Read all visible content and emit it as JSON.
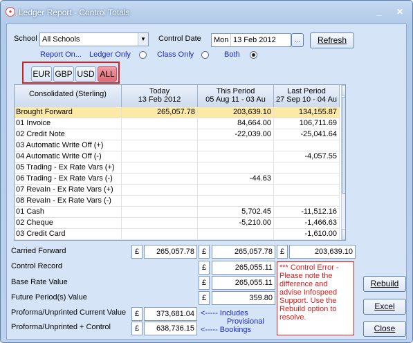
{
  "window": {
    "title": "Ledger Report - Control Totals",
    "icon": "app-icon",
    "minimize": "_",
    "close": "✕"
  },
  "school": {
    "label": "School",
    "value": "All Schools"
  },
  "control_date": {
    "label": "Control Date",
    "day": "Mon",
    "date": "13 Feb 2012",
    "picker": "..."
  },
  "refresh_label": "Refresh",
  "report_on": {
    "label": "Report On...",
    "options": [
      {
        "label": "Ledger Only",
        "selected": false
      },
      {
        "label": "Class Only",
        "selected": false
      },
      {
        "label": "Both",
        "selected": true
      }
    ]
  },
  "currencies": [
    {
      "label": "EUR",
      "active": false
    },
    {
      "label": "GBP",
      "active": false
    },
    {
      "label": "USD",
      "active": false
    },
    {
      "label": "ALL",
      "active": true
    }
  ],
  "grid": {
    "columns": [
      {
        "line1": "Consolidated (Sterling)",
        "line2": ""
      },
      {
        "line1": "Today",
        "line2": "13 Feb 2012"
      },
      {
        "line1": "This Period",
        "line2": "05 Aug 11 - 03 Au"
      },
      {
        "line1": "Last Period",
        "line2": "27 Sep 10 - 04 Au"
      }
    ],
    "rows": [
      {
        "name": "Brought Forward",
        "today": "265,057.78",
        "this": "203,639.10",
        "last": "134,155.87"
      },
      {
        "name": "01 Invoice",
        "today": "",
        "this": "84,664.00",
        "last": "106,711.69"
      },
      {
        "name": "02 Credit Note",
        "today": "",
        "this": "-22,039.00",
        "last": "-25,041.64"
      },
      {
        "name": "03 Automatic Write Off (+)",
        "today": "",
        "this": "",
        "last": ""
      },
      {
        "name": "04 Automatic Write Off (-)",
        "today": "",
        "this": "",
        "last": "-4,057.55"
      },
      {
        "name": "05 Trading - Ex Rate Vars (+)",
        "today": "",
        "this": "",
        "last": ""
      },
      {
        "name": "06 Trading - Ex Rate Vars (-)",
        "today": "",
        "this": "-44.63",
        "last": ""
      },
      {
        "name": "07 RevaIn - Ex Rate Vars (+)",
        "today": "",
        "this": "",
        "last": ""
      },
      {
        "name": "08 RevaIn - Ex Rate Vars (-)",
        "today": "",
        "this": "",
        "last": ""
      },
      {
        "name": "01 Cash",
        "today": "",
        "this": "5,702.45",
        "last": "-11,512.16"
      },
      {
        "name": "02 Cheque",
        "today": "",
        "this": "-5,210.00",
        "last": "-1,466.63"
      },
      {
        "name": "03 Credit Card",
        "today": "",
        "this": "",
        "last": "-1,610.00"
      }
    ]
  },
  "totals": {
    "currency_symbol": "£",
    "carried_forward": {
      "label": "Carried Forward",
      "today": "265,057.78",
      "this": "265,057.78",
      "last": "203,639.10"
    },
    "control_record": {
      "label": "Control Record",
      "value": "265,055.11"
    },
    "base_rate": {
      "label": "Base Rate Value",
      "value": "265,055.11"
    },
    "future": {
      "label": "Future Period(s) Value",
      "value": "359.80"
    },
    "proforma_current": {
      "label": "Proforma/Unprinted Current Value",
      "value": "373,681.04"
    },
    "proforma_control": {
      "label": "Proforma/Unprinted + Control",
      "value": "638,736.15"
    },
    "note": {
      "line1": "<-----  Includes",
      "line2": "Provisional",
      "line3": "<-----  Bookings"
    }
  },
  "error_text": "*** Control Error - Please note the difference and advise Infospeed Support.  Use the Rebuild option to resolve.",
  "buttons": {
    "rebuild": "Rebuild",
    "excel": "Excel",
    "close": "Close"
  },
  "colors": {
    "accent_red": "#d42020",
    "selected_row": "#fde9a6",
    "active_currency": "#e97b85"
  }
}
